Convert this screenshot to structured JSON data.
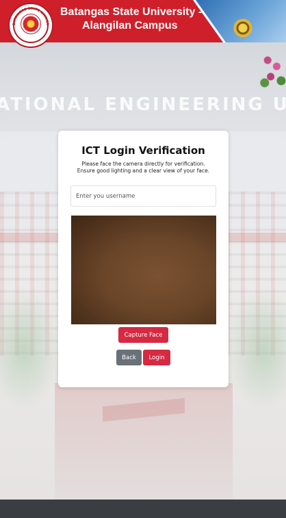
{
  "header": {
    "title_line1": "Batangas State University -",
    "title_line2": "Alangilan Campus",
    "logo_text": "BATANGAS STATE UNIVERSITY"
  },
  "background": {
    "building_text": "ATIONAL ENGINEERING U"
  },
  "verification": {
    "title": "ICT Login Verification",
    "subtitle_line1": "Please face the camera directly for verification.",
    "subtitle_line2": "Ensure good lighting and a clear view of your face.",
    "username_placeholder": "Enter you username",
    "username_value": "",
    "capture_label": "Capture Face",
    "back_label": "Back",
    "login_label": "Login"
  },
  "colors": {
    "header_red": "#cf1f2a",
    "primary_button": "#d52a42",
    "secondary_button": "#6b7179",
    "footer": "#3a3d42"
  }
}
